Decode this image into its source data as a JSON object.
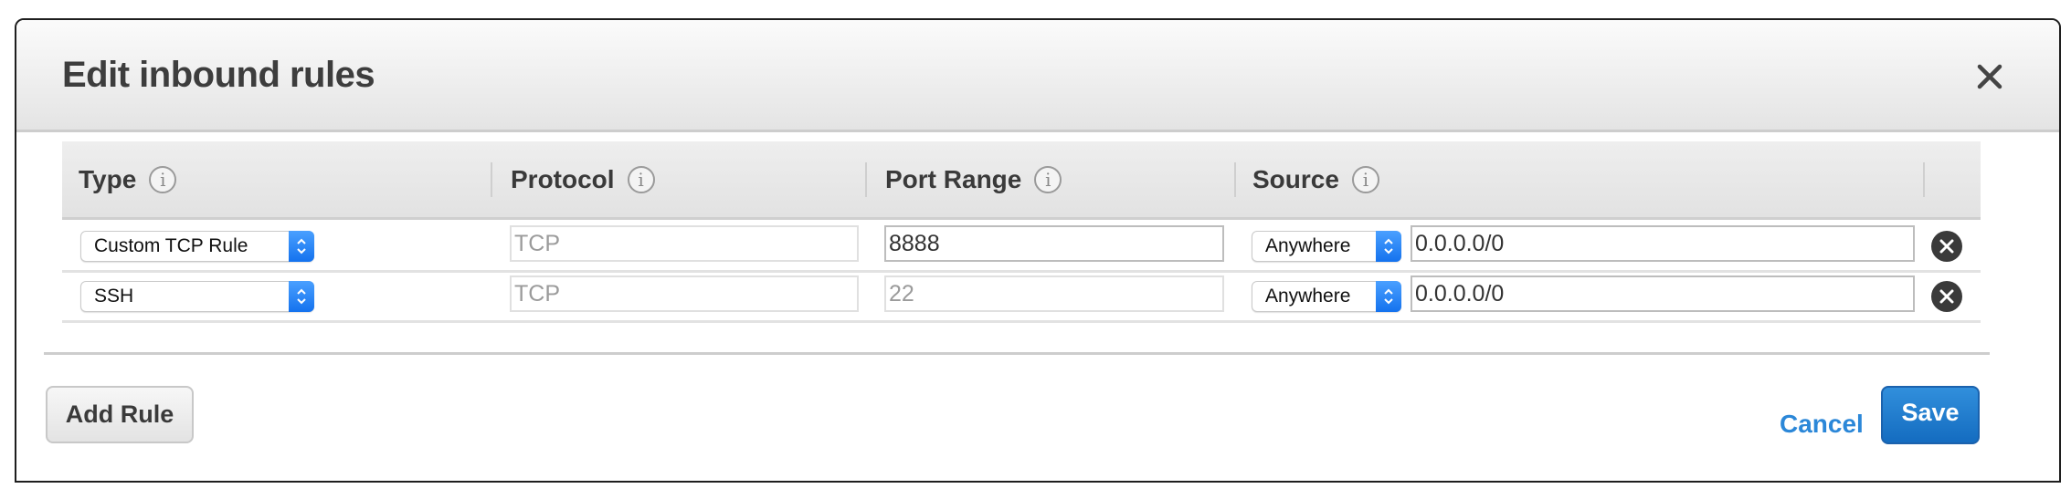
{
  "dialog": {
    "title": "Edit inbound rules",
    "close_icon": "close-icon"
  },
  "table": {
    "columns": [
      {
        "label": "Type",
        "info_icon": "info-icon"
      },
      {
        "label": "Protocol",
        "info_icon": "info-icon"
      },
      {
        "label": "Port Range",
        "info_icon": "info-icon"
      },
      {
        "label": "Source",
        "info_icon": "info-icon"
      }
    ],
    "info_glyph": "i",
    "rows": [
      {
        "type": "Custom TCP Rule",
        "protocol": "TCP",
        "port_range": "8888",
        "port_editable": true,
        "source_type": "Anywhere",
        "source_cidr": "0.0.0.0/0",
        "remove_icon": "remove-circle-icon"
      },
      {
        "type": "SSH",
        "protocol": "TCP",
        "port_range": "22",
        "port_editable": false,
        "source_type": "Anywhere",
        "source_cidr": "0.0.0.0/0",
        "remove_icon": "remove-circle-icon"
      }
    ]
  },
  "footer": {
    "add_rule_label": "Add Rule",
    "cancel_label": "Cancel",
    "save_label": "Save"
  },
  "colors": {
    "primary": "#1f7acb",
    "link": "#2b87d8",
    "select_accent": "#1a7cf5"
  }
}
